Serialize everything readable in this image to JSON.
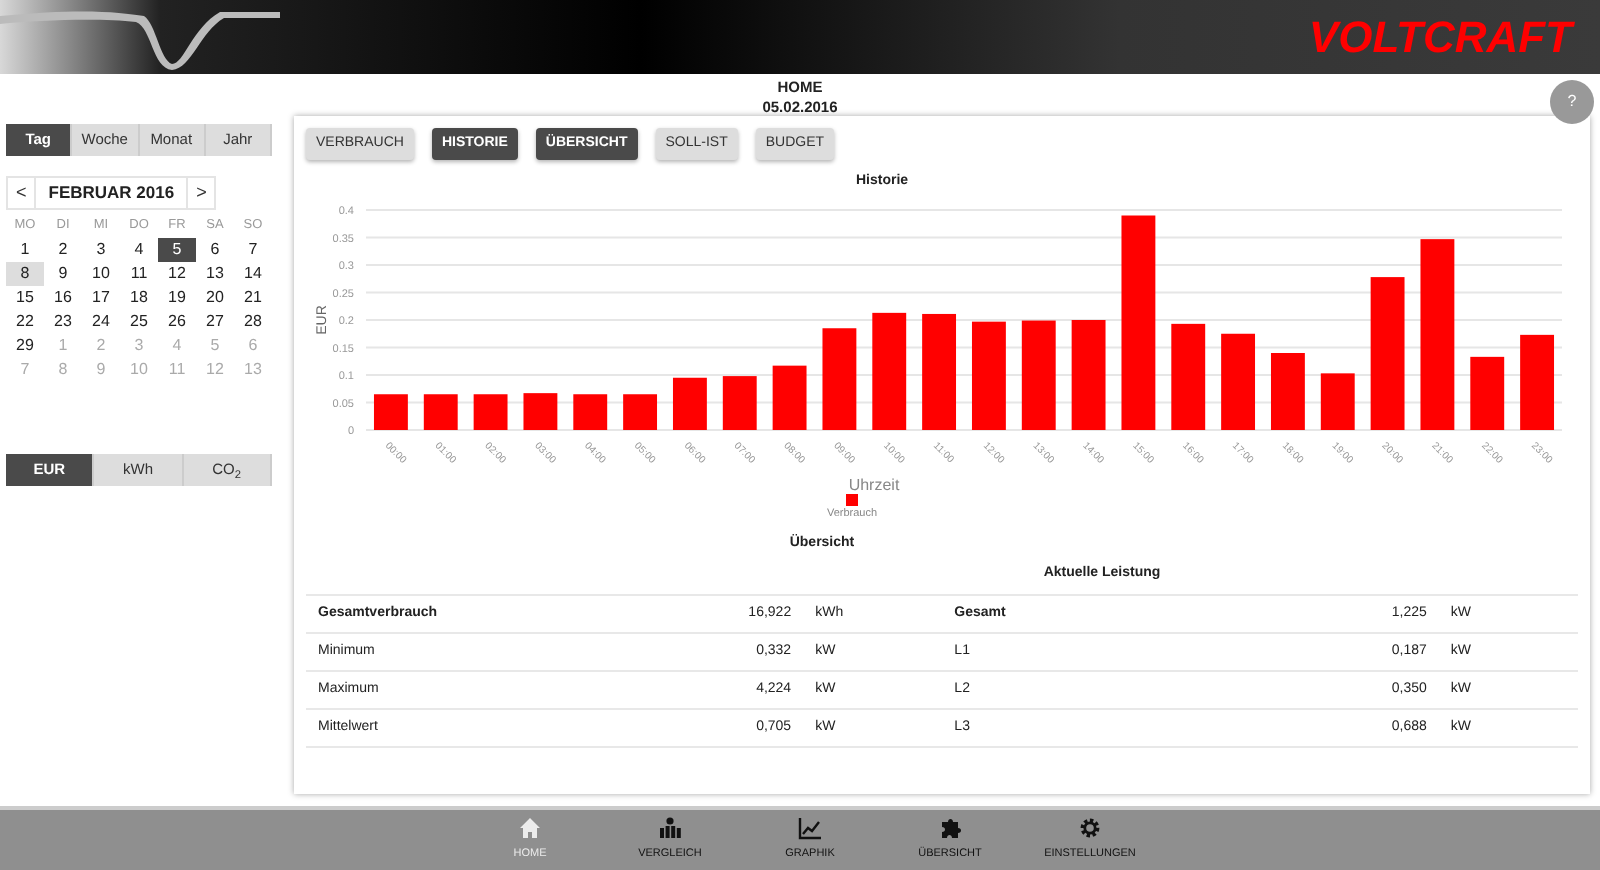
{
  "header": {
    "logo": "VOLTCRAFT",
    "help": "?"
  },
  "page_title": {
    "title": "HOME",
    "date": "05.02.2016"
  },
  "period_tabs": [
    {
      "label": "Tag",
      "selected": true
    },
    {
      "label": "Woche",
      "selected": false
    },
    {
      "label": "Monat",
      "selected": false
    },
    {
      "label": "Jahr",
      "selected": false
    }
  ],
  "calendar": {
    "prev": "<",
    "month": "FEBRUAR 2016",
    "next": ">",
    "weekdays": [
      "MO",
      "DI",
      "MI",
      "DO",
      "FR",
      "SA",
      "SO"
    ],
    "days": [
      {
        "day": "1",
        "selected": false,
        "today": false,
        "other_month": false
      },
      {
        "day": "2",
        "selected": false,
        "today": false,
        "other_month": false
      },
      {
        "day": "3",
        "selected": false,
        "today": false,
        "other_month": false
      },
      {
        "day": "4",
        "selected": false,
        "today": false,
        "other_month": false
      },
      {
        "day": "5",
        "selected": true,
        "today": false,
        "other_month": false
      },
      {
        "day": "6",
        "selected": false,
        "today": false,
        "other_month": false
      },
      {
        "day": "7",
        "selected": false,
        "today": false,
        "other_month": false
      },
      {
        "day": "8",
        "selected": false,
        "today": true,
        "other_month": false
      },
      {
        "day": "9",
        "selected": false,
        "today": false,
        "other_month": false
      },
      {
        "day": "10",
        "selected": false,
        "today": false,
        "other_month": false
      },
      {
        "day": "11",
        "selected": false,
        "today": false,
        "other_month": false
      },
      {
        "day": "12",
        "selected": false,
        "today": false,
        "other_month": false
      },
      {
        "day": "13",
        "selected": false,
        "today": false,
        "other_month": false
      },
      {
        "day": "14",
        "selected": false,
        "today": false,
        "other_month": false
      },
      {
        "day": "15",
        "selected": false,
        "today": false,
        "other_month": false
      },
      {
        "day": "16",
        "selected": false,
        "today": false,
        "other_month": false
      },
      {
        "day": "17",
        "selected": false,
        "today": false,
        "other_month": false
      },
      {
        "day": "18",
        "selected": false,
        "today": false,
        "other_month": false
      },
      {
        "day": "19",
        "selected": false,
        "today": false,
        "other_month": false
      },
      {
        "day": "20",
        "selected": false,
        "today": false,
        "other_month": false
      },
      {
        "day": "21",
        "selected": false,
        "today": false,
        "other_month": false
      },
      {
        "day": "22",
        "selected": false,
        "today": false,
        "other_month": false
      },
      {
        "day": "23",
        "selected": false,
        "today": false,
        "other_month": false
      },
      {
        "day": "24",
        "selected": false,
        "today": false,
        "other_month": false
      },
      {
        "day": "25",
        "selected": false,
        "today": false,
        "other_month": false
      },
      {
        "day": "26",
        "selected": false,
        "today": false,
        "other_month": false
      },
      {
        "day": "27",
        "selected": false,
        "today": false,
        "other_month": false
      },
      {
        "day": "28",
        "selected": false,
        "today": false,
        "other_month": false
      },
      {
        "day": "29",
        "selected": false,
        "today": false,
        "other_month": false
      },
      {
        "day": "1",
        "selected": false,
        "today": false,
        "other_month": true
      },
      {
        "day": "2",
        "selected": false,
        "today": false,
        "other_month": true
      },
      {
        "day": "3",
        "selected": false,
        "today": false,
        "other_month": true
      },
      {
        "day": "4",
        "selected": false,
        "today": false,
        "other_month": true
      },
      {
        "day": "5",
        "selected": false,
        "today": false,
        "other_month": true
      },
      {
        "day": "6",
        "selected": false,
        "today": false,
        "other_month": true
      },
      {
        "day": "7",
        "selected": false,
        "today": false,
        "other_month": true
      },
      {
        "day": "8",
        "selected": false,
        "today": false,
        "other_month": true
      },
      {
        "day": "9",
        "selected": false,
        "today": false,
        "other_month": true
      },
      {
        "day": "10",
        "selected": false,
        "today": false,
        "other_month": true
      },
      {
        "day": "11",
        "selected": false,
        "today": false,
        "other_month": true
      },
      {
        "day": "12",
        "selected": false,
        "today": false,
        "other_month": true
      },
      {
        "day": "13",
        "selected": false,
        "today": false,
        "other_month": true
      }
    ]
  },
  "unit_tabs": [
    {
      "label": "EUR",
      "selected": true
    },
    {
      "label": "kWh",
      "selected": false
    },
    {
      "label": "CO$_{2}$",
      "selected": false
    }
  ],
  "view_buttons": [
    {
      "label": "VERBRAUCH",
      "selected": false
    },
    {
      "label": "HISTORIE",
      "selected": true
    },
    {
      "label": "ÜBERSICHT",
      "selected": true
    },
    {
      "label": "SOLL-IST",
      "selected": false
    },
    {
      "label": "BUDGET",
      "selected": false
    }
  ],
  "chart": {
    "chart_data": {
      "type": "bar",
      "title": "Historie",
      "xlabel": "Uhrzeit",
      "ylabel": "EUR",
      "categories": [
        "00:00",
        "01:00",
        "02:00",
        "03:00",
        "04:00",
        "05:00",
        "06:00",
        "07:00",
        "08:00",
        "09:00",
        "10:00",
        "11:00",
        "12:00",
        "13:00",
        "14:00",
        "15:00",
        "16:00",
        "17:00",
        "18:00",
        "19:00",
        "20:00",
        "21:00",
        "22:00",
        "23:00"
      ],
      "series": [
        {
          "name": "Verbrauch",
          "color": "#ff0000",
          "values": [
            0.065,
            0.065,
            0.065,
            0.067,
            0.065,
            0.065,
            0.095,
            0.098,
            0.117,
            0.185,
            0.213,
            0.211,
            0.197,
            0.199,
            0.2,
            0.39,
            0.193,
            0.175,
            0.14,
            0.103,
            0.278,
            0.347,
            0.133,
            0.173
          ]
        }
      ],
      "ylim": [
        0,
        0.4
      ],
      "grid": true,
      "yticks": [
        {
          "value": 0,
          "label": "0"
        },
        {
          "value": 0.05,
          "label": "0.05"
        },
        {
          "value": 0.1,
          "label": "0.1"
        },
        {
          "value": 0.15,
          "label": "0.15"
        },
        {
          "value": 0.2,
          "label": "0.2"
        },
        {
          "value": 0.25,
          "label": "0.25"
        },
        {
          "value": 0.3,
          "label": "0.3"
        },
        {
          "value": 0.35,
          "label": "0.35"
        },
        {
          "value": 0.4,
          "label": "0.4"
        }
      ]
    }
  },
  "overview": {
    "title": "Übersicht",
    "subtitle": "Aktuelle Leistung",
    "rows": [
      {
        "emphasis": true,
        "left": {
          "label": "Gesamtverbrauch",
          "value": "16,922",
          "unit": "kWh"
        },
        "right": {
          "label": "Gesamt",
          "value": "1,225",
          "unit": "kW"
        }
      },
      {
        "emphasis": false,
        "left": {
          "label": "Minimum",
          "value": "0,332",
          "unit": "kW"
        },
        "right": {
          "label": "L1",
          "value": "0,187",
          "unit": "kW"
        }
      },
      {
        "emphasis": false,
        "left": {
          "label": "Maximum",
          "value": "4,224",
          "unit": "kW"
        },
        "right": {
          "label": "L2",
          "value": "0,350",
          "unit": "kW"
        }
      },
      {
        "emphasis": false,
        "left": {
          "label": "Mittelwert",
          "value": "0,705",
          "unit": "kW"
        },
        "right": {
          "label": "L3",
          "value": "0,688",
          "unit": "kW"
        }
      }
    ]
  },
  "bottom_nav": [
    {
      "kind": "home",
      "label": "HOME",
      "selected": true
    },
    {
      "kind": "compare",
      "label": "VERGLEICH",
      "selected": false
    },
    {
      "kind": "graph",
      "label": "GRAPHIK",
      "selected": false
    },
    {
      "kind": "overview",
      "label": "ÜBERSICHT",
      "selected": false
    },
    {
      "kind": "settings",
      "label": "EINSTELLUNGEN",
      "selected": false
    }
  ]
}
